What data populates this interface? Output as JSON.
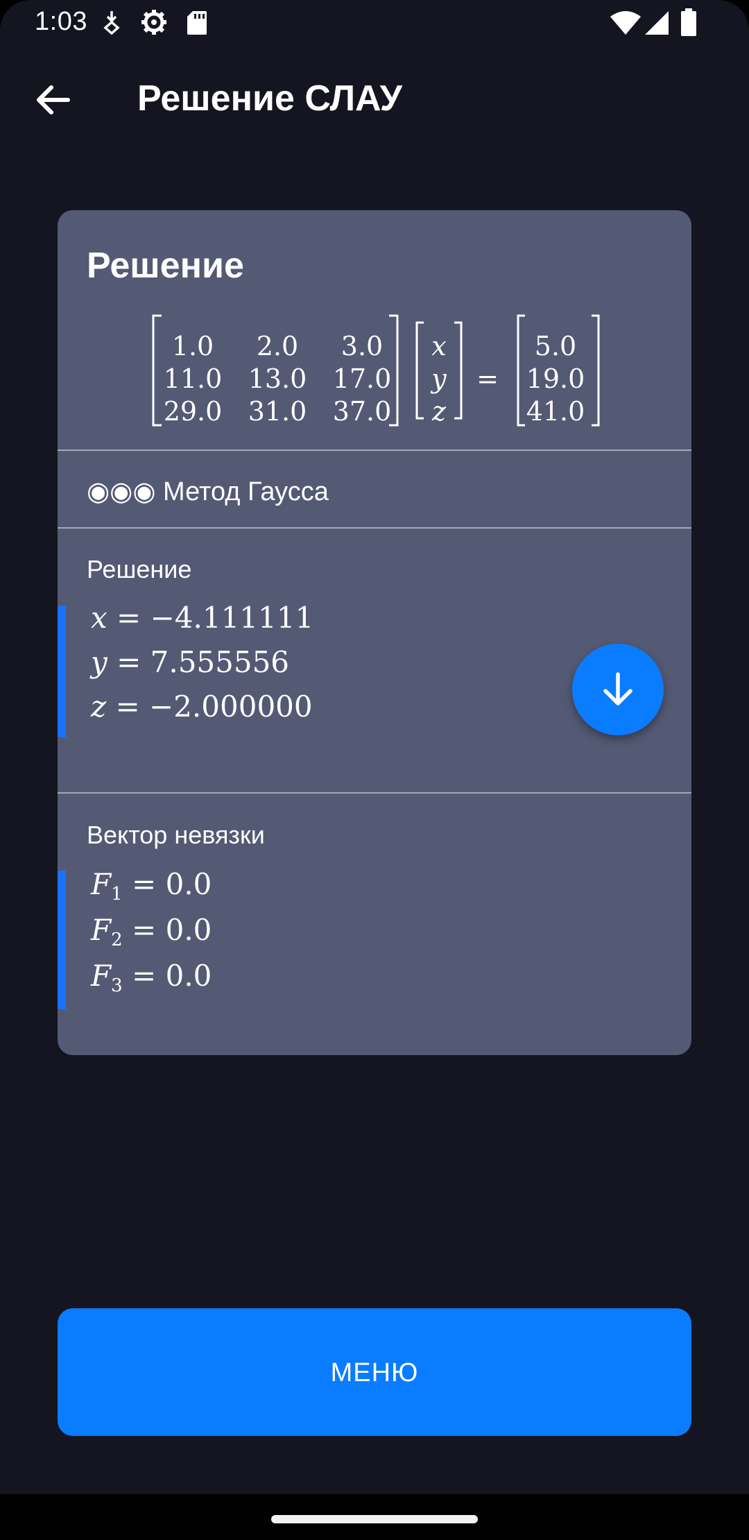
{
  "status_bar": {
    "time": "1:03",
    "icons": [
      "download-icon",
      "settings-gear-icon",
      "sd-card-icon",
      "wifi-icon",
      "cellular-signal-icon",
      "battery-icon"
    ]
  },
  "app_bar": {
    "back_icon": "arrow-back-icon",
    "title": "Решение СЛАУ"
  },
  "card": {
    "title": "Решение",
    "equation": {
      "matrix": [
        [
          "1.0",
          "2.0",
          "3.0"
        ],
        [
          "11.0",
          "13.0",
          "17.0"
        ],
        [
          "29.0",
          "31.0",
          "37.0"
        ]
      ],
      "variables": [
        "x",
        "y",
        "z"
      ],
      "equals": "=",
      "rhs": [
        "5.0",
        "19.0",
        "41.0"
      ]
    },
    "method": "◉◉◉ Метод Гаусса",
    "solution": {
      "label": "Решение",
      "lines": [
        {
          "var": "x",
          "eq": " = −4.111111"
        },
        {
          "var": "y",
          "eq": " = 7.555556"
        },
        {
          "var": "z",
          "eq": " = −2.000000"
        }
      ]
    },
    "residual": {
      "label": "Вектор невязки",
      "lines": [
        {
          "var": "F",
          "sub": "1",
          "eq": " = 0.0"
        },
        {
          "var": "F",
          "sub": "2",
          "eq": " = 0.0"
        },
        {
          "var": "F",
          "sub": "3",
          "eq": " = 0.0"
        }
      ]
    },
    "fab_icon": "arrow-down-icon"
  },
  "menu_button": {
    "label": "МЕНЮ"
  },
  "colors": {
    "background": "#141520",
    "card": "#545974",
    "accent": "#0a7cff"
  }
}
